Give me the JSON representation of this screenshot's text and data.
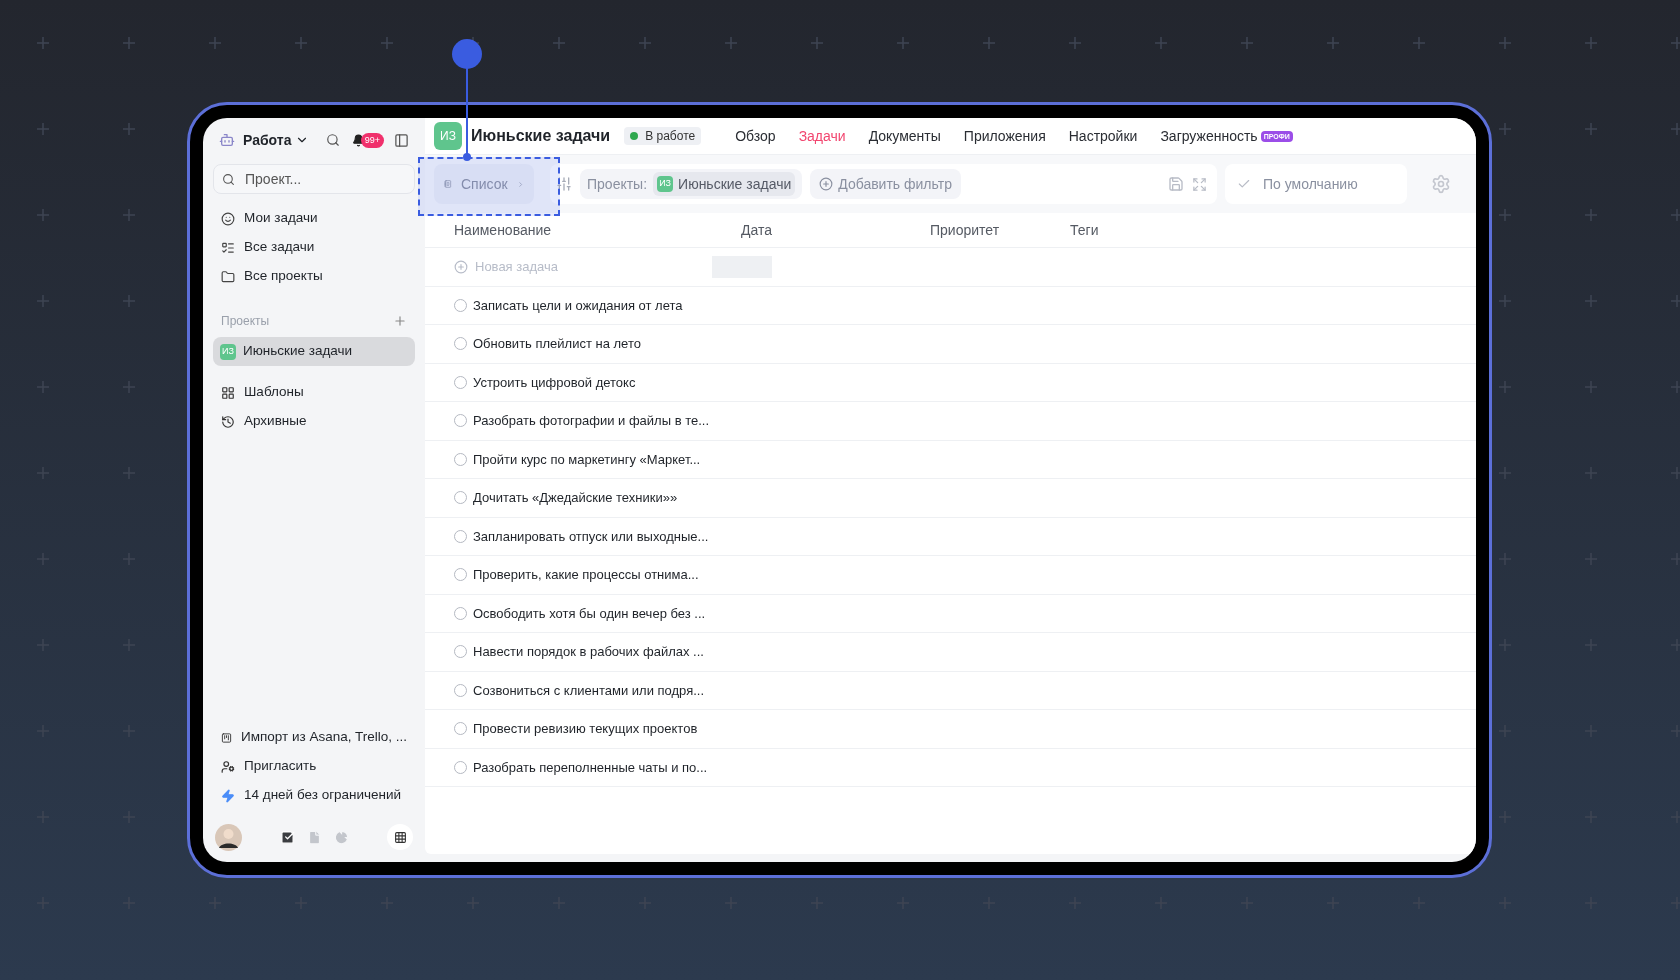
{
  "sidebar": {
    "workspace": "Работа",
    "notification_badge": "99+",
    "search": {
      "placeholder": "Проект..."
    },
    "nav": [
      {
        "label": "Мои задачи"
      },
      {
        "label": "Все задачи"
      },
      {
        "label": "Все проекты"
      }
    ],
    "projects_heading": "Проекты",
    "projects": [
      {
        "initials": "ИЗ",
        "name": "Июньские задачи",
        "selected": true
      }
    ],
    "extras": [
      {
        "label": "Шаблоны"
      },
      {
        "label": "Архивные"
      }
    ],
    "footer_links": [
      {
        "label": "Импорт из Asana, Trello, ..."
      },
      {
        "label": "Пригласить"
      },
      {
        "label": "14 дней без ограничений"
      }
    ],
    "bottom_tabs": [
      {
        "selected": true
      },
      {
        "selected": false
      },
      {
        "selected": false
      }
    ]
  },
  "header": {
    "initials": "ИЗ",
    "title": "Июньские задачи",
    "status": {
      "label": "В работе",
      "color": "#2fa84f"
    },
    "tabs": [
      {
        "label": "Обзор",
        "selected": false
      },
      {
        "label": "Задачи",
        "selected": true
      },
      {
        "label": "Документы",
        "selected": false
      },
      {
        "label": "Приложения",
        "selected": false
      },
      {
        "label": "Настройки",
        "selected": false
      },
      {
        "label": "Загруженность",
        "selected": false,
        "badge": "ПРОФИ"
      }
    ]
  },
  "toolbar": {
    "view": "Список",
    "filter_label": "Проекты:",
    "filter_chip": {
      "initials": "ИЗ",
      "label": "Июньские задачи"
    },
    "add_filter": "Добавить фильтр",
    "preset": "По умолчанию"
  },
  "table": {
    "columns": [
      "Наименование",
      "Дата",
      "Приоритет",
      "Теги"
    ],
    "new_task": {
      "placeholder": "Новая задача"
    },
    "rows": [
      {
        "name": "Записать цели и ожидания от лета",
        "checked": false
      },
      {
        "name": "Обновить плейлист на лето",
        "checked": false
      },
      {
        "name": "Устроить цифровой детокс",
        "checked": false
      },
      {
        "name": "Разобрать фотографии и файлы в те...",
        "checked": false
      },
      {
        "name": "Пройти курс по маркетингу «Маркет...",
        "checked": false
      },
      {
        "name": "Дочитать «Джедайские техники»»",
        "checked": false
      },
      {
        "name": "Запланировать отпуск или выходные...",
        "checked": false
      },
      {
        "name": "Проверить, какие процессы отнима...",
        "checked": false
      },
      {
        "name": "Освободить хотя бы один вечер без ...",
        "checked": false
      },
      {
        "name": "Навести порядок в рабочих файлах ...",
        "checked": false
      },
      {
        "name": "Созвониться с клиентами или подря...",
        "checked": false
      },
      {
        "name": "Провести ревизию текущих проектов",
        "checked": false
      },
      {
        "name": "Разобрать переполненные чаты и по...",
        "checked": false
      }
    ]
  }
}
